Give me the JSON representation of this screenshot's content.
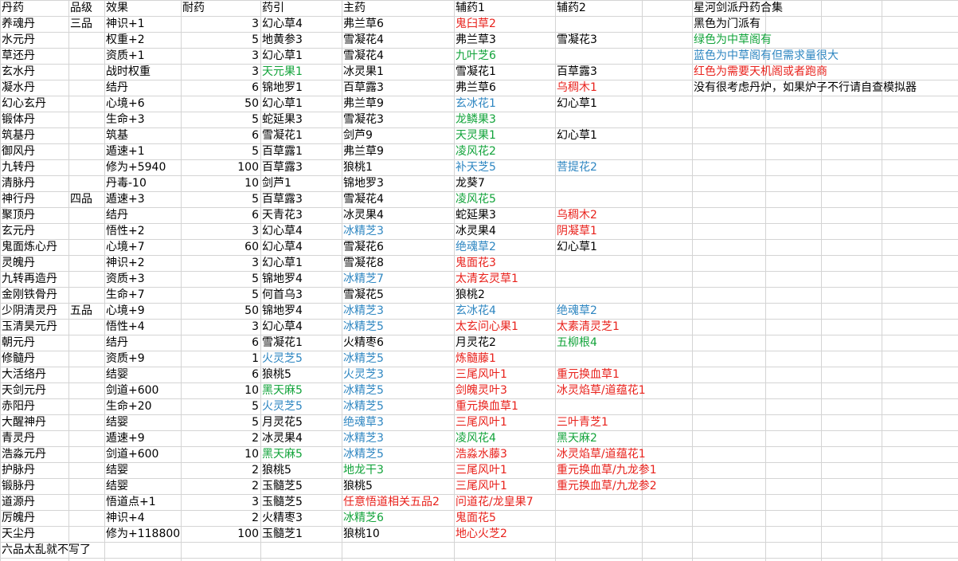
{
  "sheet": {
    "headers": [
      "丹药",
      "品级",
      "效果",
      "耐药",
      "药引",
      "主药",
      "辅药1",
      "辅药2",
      "",
      "星河剑派丹药合集"
    ],
    "rows": [
      [
        {
          "t": "养魂丹"
        },
        {
          "t": "三品"
        },
        {
          "t": "神识+1"
        },
        {
          "t": "3"
        },
        {
          "t": "幻心草4"
        },
        {
          "t": "弗兰草6"
        },
        {
          "t": "鬼臼草2",
          "c": "red"
        },
        {
          "t": ""
        }
      ],
      [
        {
          "t": "水元丹"
        },
        {
          "t": ""
        },
        {
          "t": "权重+2"
        },
        {
          "t": "5"
        },
        {
          "t": "地黄参3"
        },
        {
          "t": "雪凝花4"
        },
        {
          "t": "弗兰草3"
        },
        {
          "t": "雪凝花3"
        }
      ],
      [
        {
          "t": "草还丹"
        },
        {
          "t": ""
        },
        {
          "t": "资质+1"
        },
        {
          "t": "3"
        },
        {
          "t": "幻心草1"
        },
        {
          "t": "雪凝花4"
        },
        {
          "t": "九叶芝6",
          "c": "green"
        },
        {
          "t": ""
        }
      ],
      [
        {
          "t": "玄水丹"
        },
        {
          "t": ""
        },
        {
          "t": "战时权重"
        },
        {
          "t": "3"
        },
        {
          "t": "天元果1",
          "c": "green"
        },
        {
          "t": "冰灵果1"
        },
        {
          "t": "雪凝花1"
        },
        {
          "t": "百草露3"
        }
      ],
      [
        {
          "t": "凝水丹"
        },
        {
          "t": ""
        },
        {
          "t": "结丹"
        },
        {
          "t": "6"
        },
        {
          "t": "锦地罗1"
        },
        {
          "t": "百草露3"
        },
        {
          "t": "弗兰草6"
        },
        {
          "t": "乌稠木1",
          "c": "red"
        }
      ],
      [
        {
          "t": "幻心玄丹"
        },
        {
          "t": ""
        },
        {
          "t": "心境+6"
        },
        {
          "t": "50"
        },
        {
          "t": "幻心草1"
        },
        {
          "t": "弗兰草9"
        },
        {
          "t": "玄冰花1",
          "c": "blue"
        },
        {
          "t": "幻心草1"
        }
      ],
      [
        {
          "t": "锻体丹"
        },
        {
          "t": ""
        },
        {
          "t": "生命+3"
        },
        {
          "t": "5"
        },
        {
          "t": "蛇延果3"
        },
        {
          "t": "雪凝花3"
        },
        {
          "t": "龙鳞果3",
          "c": "green"
        },
        {
          "t": ""
        }
      ],
      [
        {
          "t": "筑基丹"
        },
        {
          "t": ""
        },
        {
          "t": "筑基"
        },
        {
          "t": "6"
        },
        {
          "t": "雪凝花1"
        },
        {
          "t": "剑芦9"
        },
        {
          "t": "天灵果1",
          "c": "green"
        },
        {
          "t": "幻心草1"
        }
      ],
      [
        {
          "t": "御风丹"
        },
        {
          "t": ""
        },
        {
          "t": "遁速+1"
        },
        {
          "t": "5"
        },
        {
          "t": "百草露1"
        },
        {
          "t": "弗兰草9"
        },
        {
          "t": "凌风花2",
          "c": "green"
        },
        {
          "t": ""
        }
      ],
      [
        {
          "t": "九转丹"
        },
        {
          "t": ""
        },
        {
          "t": "修为+5940"
        },
        {
          "t": "100"
        },
        {
          "t": "百草露3"
        },
        {
          "t": "狼桃1"
        },
        {
          "t": "补天芝5",
          "c": "blue"
        },
        {
          "t": "菩提花2",
          "c": "blue"
        }
      ],
      [
        {
          "t": "清脉丹"
        },
        {
          "t": ""
        },
        {
          "t": "丹毒-10"
        },
        {
          "t": "10"
        },
        {
          "t": "剑芦1"
        },
        {
          "t": "锦地罗3"
        },
        {
          "t": "龙葵7"
        },
        {
          "t": ""
        }
      ],
      [
        {
          "t": "神行丹"
        },
        {
          "t": "四品"
        },
        {
          "t": "遁速+3"
        },
        {
          "t": "5"
        },
        {
          "t": "百草露3"
        },
        {
          "t": "雪凝花4"
        },
        {
          "t": "凌风花5",
          "c": "green"
        },
        {
          "t": ""
        }
      ],
      [
        {
          "t": "聚顶丹"
        },
        {
          "t": ""
        },
        {
          "t": "结丹"
        },
        {
          "t": "6"
        },
        {
          "t": "天青花3"
        },
        {
          "t": "冰灵果4"
        },
        {
          "t": "蛇延果3"
        },
        {
          "t": "乌稠木2",
          "c": "red"
        }
      ],
      [
        {
          "t": "玄元丹"
        },
        {
          "t": ""
        },
        {
          "t": "悟性+2"
        },
        {
          "t": "3"
        },
        {
          "t": "幻心草4"
        },
        {
          "t": "冰精芝3",
          "c": "blue"
        },
        {
          "t": "冰灵果4"
        },
        {
          "t": "阴凝草1",
          "c": "red"
        }
      ],
      [
        {
          "t": "鬼面炼心丹"
        },
        {
          "t": ""
        },
        {
          "t": "心境+7"
        },
        {
          "t": "60"
        },
        {
          "t": "幻心草4"
        },
        {
          "t": "雪凝花6"
        },
        {
          "t": "绝魂草2",
          "c": "blue"
        },
        {
          "t": "幻心草1"
        }
      ],
      [
        {
          "t": "灵魄丹"
        },
        {
          "t": ""
        },
        {
          "t": "神识+2"
        },
        {
          "t": "3"
        },
        {
          "t": "幻心草1"
        },
        {
          "t": "雪凝花8"
        },
        {
          "t": "鬼面花3",
          "c": "red"
        },
        {
          "t": ""
        }
      ],
      [
        {
          "t": "九转再造丹"
        },
        {
          "t": ""
        },
        {
          "t": "资质+3"
        },
        {
          "t": "5"
        },
        {
          "t": "锦地罗4"
        },
        {
          "t": "冰精芝7",
          "c": "blue"
        },
        {
          "t": "太清玄灵草1",
          "c": "red"
        },
        {
          "t": ""
        }
      ],
      [
        {
          "t": "金刚铁骨丹"
        },
        {
          "t": ""
        },
        {
          "t": "生命+7"
        },
        {
          "t": "5"
        },
        {
          "t": "何首乌3"
        },
        {
          "t": "雪凝花5"
        },
        {
          "t": "狼桃2"
        },
        {
          "t": ""
        }
      ],
      [
        {
          "t": "少阴清灵丹"
        },
        {
          "t": "五品"
        },
        {
          "t": "心境+9"
        },
        {
          "t": "50"
        },
        {
          "t": "锦地罗4"
        },
        {
          "t": "冰精芝3",
          "c": "blue"
        },
        {
          "t": "玄冰花4",
          "c": "blue"
        },
        {
          "t": "绝魂草2",
          "c": "blue"
        }
      ],
      [
        {
          "t": "玉清昊元丹"
        },
        {
          "t": ""
        },
        {
          "t": "悟性+4"
        },
        {
          "t": "3"
        },
        {
          "t": "幻心草4"
        },
        {
          "t": "冰精芝5",
          "c": "blue"
        },
        {
          "t": "太玄问心果1",
          "c": "red"
        },
        {
          "t": "太素清灵芝1",
          "c": "red"
        }
      ],
      [
        {
          "t": "朝元丹"
        },
        {
          "t": ""
        },
        {
          "t": "结丹"
        },
        {
          "t": "6"
        },
        {
          "t": "雪凝花1"
        },
        {
          "t": "火精枣6"
        },
        {
          "t": "月灵花2"
        },
        {
          "t": "五柳根4",
          "c": "green"
        }
      ],
      [
        {
          "t": "修髓丹"
        },
        {
          "t": ""
        },
        {
          "t": "资质+9"
        },
        {
          "t": "1"
        },
        {
          "t": "火灵芝5",
          "c": "blue"
        },
        {
          "t": "冰精芝5",
          "c": "blue"
        },
        {
          "t": "炼髓藤1",
          "c": "red"
        },
        {
          "t": ""
        }
      ],
      [
        {
          "t": "大活络丹"
        },
        {
          "t": ""
        },
        {
          "t": "结婴"
        },
        {
          "t": "6"
        },
        {
          "t": "狼桃5"
        },
        {
          "t": "火灵芝3",
          "c": "blue"
        },
        {
          "t": "三尾风叶1",
          "c": "red"
        },
        {
          "t": "重元换血草1",
          "c": "red"
        }
      ],
      [
        {
          "t": "天剑元丹"
        },
        {
          "t": ""
        },
        {
          "t": "剑道+600"
        },
        {
          "t": "10"
        },
        {
          "t": "黑天麻5",
          "c": "green"
        },
        {
          "t": "冰精芝5",
          "c": "blue"
        },
        {
          "t": "剑魄灵叶3",
          "c": "red"
        },
        {
          "t": "冰灵焰草/道蕴花1",
          "c": "red"
        }
      ],
      [
        {
          "t": "赤阳丹"
        },
        {
          "t": ""
        },
        {
          "t": "生命+20"
        },
        {
          "t": "5"
        },
        {
          "t": "火灵芝5",
          "c": "blue"
        },
        {
          "t": "冰精芝5",
          "c": "blue"
        },
        {
          "t": "重元换血草1",
          "c": "red"
        },
        {
          "t": ""
        }
      ],
      [
        {
          "t": "大醒神丹"
        },
        {
          "t": ""
        },
        {
          "t": "结婴"
        },
        {
          "t": "5"
        },
        {
          "t": "月灵花5"
        },
        {
          "t": "绝魂草3",
          "c": "blue"
        },
        {
          "t": "三尾风叶1",
          "c": "red"
        },
        {
          "t": "三叶青芝1",
          "c": "red"
        }
      ],
      [
        {
          "t": "青灵丹"
        },
        {
          "t": ""
        },
        {
          "t": "遁速+9"
        },
        {
          "t": "2"
        },
        {
          "t": "冰灵果4"
        },
        {
          "t": "冰精芝3",
          "c": "blue"
        },
        {
          "t": "凌风花4",
          "c": "green"
        },
        {
          "t": "黑天麻2",
          "c": "green"
        }
      ],
      [
        {
          "t": "浩淼元丹"
        },
        {
          "t": ""
        },
        {
          "t": "剑道+600"
        },
        {
          "t": "10"
        },
        {
          "t": "黑天麻5",
          "c": "green"
        },
        {
          "t": "冰精芝5",
          "c": "blue"
        },
        {
          "t": "浩淼水藤3",
          "c": "red"
        },
        {
          "t": "冰灵焰草/道蕴花1",
          "c": "red"
        }
      ],
      [
        {
          "t": "护脉丹"
        },
        {
          "t": ""
        },
        {
          "t": "结婴"
        },
        {
          "t": "2"
        },
        {
          "t": "狼桃5"
        },
        {
          "t": "地龙干3",
          "c": "green"
        },
        {
          "t": "三尾风叶1",
          "c": "red"
        },
        {
          "t": "重元换血草/九龙参1",
          "c": "red"
        }
      ],
      [
        {
          "t": "锻脉丹"
        },
        {
          "t": ""
        },
        {
          "t": "结婴"
        },
        {
          "t": "2"
        },
        {
          "t": "玉髓芝5"
        },
        {
          "t": "狼桃5"
        },
        {
          "t": "三尾风叶1",
          "c": "red"
        },
        {
          "t": "重元换血草/九龙参2",
          "c": "red"
        }
      ],
      [
        {
          "t": "道源丹"
        },
        {
          "t": ""
        },
        {
          "t": "悟道点+1"
        },
        {
          "t": "3"
        },
        {
          "t": "玉髓芝5"
        },
        {
          "t": "任意悟道相关五品2",
          "c": "red"
        },
        {
          "t": "问道花/龙皇果7",
          "c": "red"
        },
        {
          "t": ""
        }
      ],
      [
        {
          "t": "厉魄丹"
        },
        {
          "t": ""
        },
        {
          "t": "神识+4"
        },
        {
          "t": "2"
        },
        {
          "t": "火精枣3"
        },
        {
          "t": "冰精芝6",
          "c": "green"
        },
        {
          "t": "鬼面花5",
          "c": "red"
        },
        {
          "t": ""
        }
      ],
      [
        {
          "t": "天尘丹"
        },
        {
          "t": ""
        },
        {
          "t": "修为+118800"
        },
        {
          "t": "100"
        },
        {
          "t": "玉髓芝1"
        },
        {
          "t": "狼桃10"
        },
        {
          "t": "地心火芝2",
          "c": "red"
        },
        {
          "t": ""
        }
      ]
    ],
    "footer_note": "六品太乱就不写了",
    "legend": [
      {
        "t": "黑色为门派有",
        "c": "black"
      },
      {
        "t": "绿色为中草阁有",
        "c": "green"
      },
      {
        "t": "蓝色为中草阁有但需求量很大",
        "c": "blue"
      },
      {
        "t": "红色为需要天机阁或者跑商",
        "c": "red"
      },
      {
        "t": "没有很考虑丹炉，如果炉子不行请自查模拟器",
        "c": "black"
      }
    ],
    "colors": {
      "black": "#000000",
      "green": "#12a33a",
      "blue": "#2e86c1",
      "red": "#e8221c",
      "grid": "#d4d4d4"
    }
  }
}
